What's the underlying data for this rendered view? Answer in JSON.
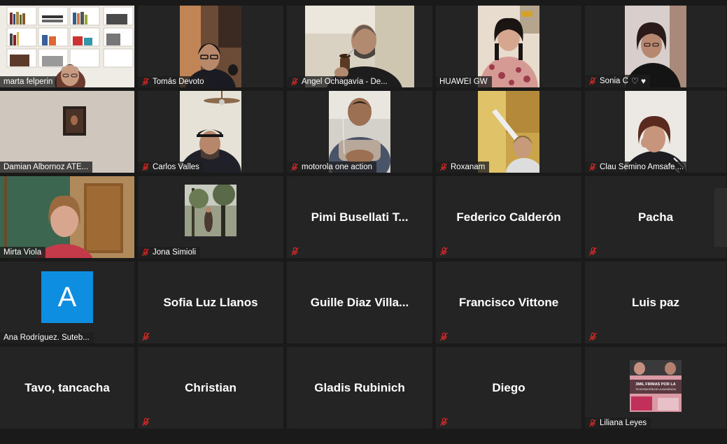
{
  "participants": [
    {
      "name": "marta felperin",
      "muted": false
    },
    {
      "name": "Tomás Devoto",
      "muted": true
    },
    {
      "name": "Angel Ochagavía - De...",
      "muted": true
    },
    {
      "name": "HUAWEI GW",
      "muted": false
    },
    {
      "name": "Sonia C",
      "muted": true,
      "suffix": "♡ ♥"
    },
    {
      "name": "Damian Albornoz ATE...",
      "muted": false
    },
    {
      "name": "Carlos Valles",
      "muted": true
    },
    {
      "name": "motorola one action",
      "muted": true
    },
    {
      "name": "Roxanam",
      "muted": true
    },
    {
      "name": "Clau Semino Amsafe ...",
      "muted": true
    },
    {
      "name": "Mirta Viola",
      "muted": false
    },
    {
      "name": "Jona Simioli",
      "muted": true
    },
    {
      "name": "Pimi  Busellati  T...",
      "muted": true
    },
    {
      "name": "Federico Calderón",
      "muted": true
    },
    {
      "name": "Pacha",
      "muted": true
    },
    {
      "name": "Ana Rodríguez. Suteb...",
      "muted": false,
      "avatar_letter": "A"
    },
    {
      "name": "Sofia Luz Llanos",
      "muted": true
    },
    {
      "name": "Guille  Diaz  Villa...",
      "muted": false
    },
    {
      "name": "Francisco Vittone",
      "muted": true
    },
    {
      "name": "Luis paz",
      "muted": true
    },
    {
      "name": "Tavo, tancacha",
      "muted": false
    },
    {
      "name": "Christian",
      "muted": true
    },
    {
      "name": "Gladis Rubinich",
      "muted": false
    },
    {
      "name": "Diego",
      "muted": true
    },
    {
      "name": "Liliana Leyes",
      "muted": true,
      "thumb_text": "3MIL FIRMAS POR LA TELEVISACIÓN DE LA AUDIENCIA"
    }
  ],
  "colors": {
    "background": "#1a1a1a",
    "tile": "#242424",
    "mute": "#e02828",
    "avatar": "#0e8ee0"
  }
}
